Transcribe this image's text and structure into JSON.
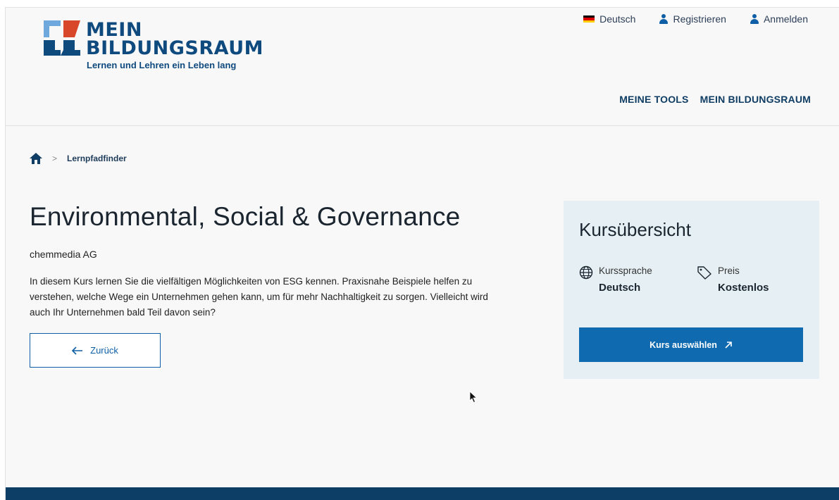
{
  "header": {
    "logo_line1": "MEIN",
    "logo_line2": "BILDUNGSRAUM",
    "logo_tagline": "Lernen und Lehren ein Leben lang",
    "language": "Deutsch",
    "register": "Registrieren",
    "login": "Anmelden",
    "nav": [
      "MEINE TOOLS",
      "MEIN BILDUNGSRAUM"
    ]
  },
  "breadcrumb": {
    "current": "Lernpfadfinder"
  },
  "course": {
    "title": "Environmental, Social & Governance",
    "provider": "chemmedia AG",
    "description": "In diesem Kurs lernen Sie die vielfältigen Möglichkeiten von ESG kennen. Praxisnahe Beispiele helfen zu verstehen, welche Wege ein Unternehmen gehen kann, um für mehr Nachhaltigkeit zu sorgen. Vielleicht wird auch Ihr Unternehmen bald Teil davon sein?",
    "back_label": "Zurück"
  },
  "overview": {
    "title": "Kursübersicht",
    "language_label": "Kurssprache",
    "language_value": "Deutsch",
    "price_label": "Preis",
    "price_value": "Kostenlos",
    "select_label": "Kurs auswählen"
  },
  "colors": {
    "brand_dark": "#0f4a7f",
    "primary": "#0f6aaf",
    "card_bg": "#e6f0f4",
    "footer": "#0d3f66",
    "logo_red": "#d9472b",
    "logo_lightblue": "#6fa8dc"
  },
  "icons": {
    "flag": "german-flag-icon",
    "user": "user-icon",
    "home": "home-icon",
    "globe": "globe-icon",
    "tag": "price-tag-icon",
    "arrow_left": "arrow-left-icon",
    "arrow_external": "arrow-up-right-icon"
  }
}
